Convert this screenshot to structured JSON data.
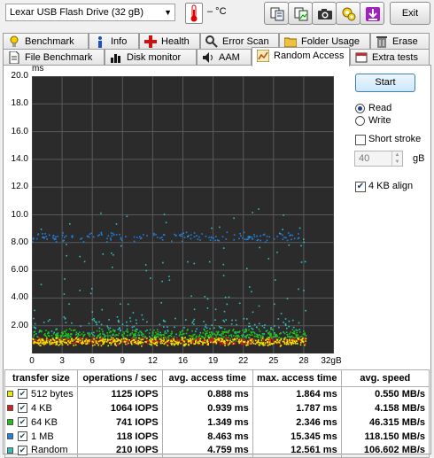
{
  "toolbar": {
    "drive": "Lexar   USB Flash Drive (32 gB)",
    "temperature": "– °C",
    "exit_label": "Exit"
  },
  "tabs_row1": [
    {
      "label": "Benchmark",
      "icon": "benchmark-icon"
    },
    {
      "label": "Info",
      "icon": "info-icon"
    },
    {
      "label": "Health",
      "icon": "health-icon"
    },
    {
      "label": "Error Scan",
      "icon": "error-scan-icon"
    },
    {
      "label": "Folder Usage",
      "icon": "folder-icon"
    },
    {
      "label": "Erase",
      "icon": "erase-icon"
    }
  ],
  "tabs_row2": [
    {
      "label": "File Benchmark",
      "icon": "file-benchmark-icon"
    },
    {
      "label": "Disk monitor",
      "icon": "disk-monitor-icon"
    },
    {
      "label": "AAM",
      "icon": "speaker-icon"
    },
    {
      "label": "Random Access",
      "icon": "random-access-icon",
      "active": true
    },
    {
      "label": "Extra tests",
      "icon": "extra-tests-icon"
    }
  ],
  "controls": {
    "start_label": "Start",
    "read_label": "Read",
    "write_label": "Write",
    "mode_selected": "Read",
    "short_stroke_label": "Short stroke",
    "short_stroke_checked": false,
    "stroke_value": "40",
    "stroke_unit": "gB",
    "align_label": "4 KB align",
    "align_checked": true
  },
  "chart_data": {
    "type": "scatter",
    "ylabel": "ms",
    "xlabel": "",
    "x_unit_label": "32gB",
    "y_ticks": [
      "20.0",
      "18.0",
      "16.0",
      "14.0",
      "12.0",
      "10.0",
      "8.00",
      "6.00",
      "4.00",
      "2.00"
    ],
    "x_ticks": [
      "0",
      "3",
      "6",
      "9",
      "12",
      "16",
      "19",
      "22",
      "25",
      "28"
    ],
    "xlim": [
      0,
      32
    ],
    "ylim": [
      0,
      20
    ],
    "grid": true,
    "background": "#2b2b2b",
    "series": [
      {
        "name": "512 bytes",
        "color": "#e8e800",
        "y_center": 0.89,
        "y_spread": 0.35,
        "x_end": 29
      },
      {
        "name": "4 KB",
        "color": "#d02020",
        "y_center": 0.94,
        "y_spread": 0.3,
        "x_end": 29
      },
      {
        "name": "64 KB",
        "color": "#20c020",
        "y_center": 1.35,
        "y_spread": 0.5,
        "x_end": 29
      },
      {
        "name": "1 MB",
        "color": "#2080e0",
        "y_center": 8.46,
        "y_spread": 0.4,
        "x_end": 29
      },
      {
        "name": "Random",
        "color": "#30c0c0",
        "y_center": 4.76,
        "y_spread": 3.5,
        "x_end": 29
      }
    ]
  },
  "results": {
    "headers": [
      "transfer size",
      "operations / sec",
      "avg. access time",
      "max. access time",
      "avg. speed"
    ],
    "rows": [
      {
        "size": "512 bytes",
        "color": "#e8e800",
        "checked": true,
        "ops": "1125 IOPS",
        "avg": "0.888 ms",
        "max": "1.864 ms",
        "speed": "0.550 MB/s"
      },
      {
        "size": "4 KB",
        "color": "#d02020",
        "checked": true,
        "ops": "1064 IOPS",
        "avg": "0.939 ms",
        "max": "1.787 ms",
        "speed": "4.158 MB/s"
      },
      {
        "size": "64 KB",
        "color": "#20c020",
        "checked": true,
        "ops": "741 IOPS",
        "avg": "1.349 ms",
        "max": "2.346 ms",
        "speed": "46.315 MB/s"
      },
      {
        "size": "1 MB",
        "color": "#2080e0",
        "checked": true,
        "ops": "118 IOPS",
        "avg": "8.463 ms",
        "max": "15.345 ms",
        "speed": "118.150 MB/s"
      },
      {
        "size": "Random",
        "color": "#30c0c0",
        "checked": true,
        "ops": "210 IOPS",
        "avg": "4.759 ms",
        "max": "12.561 ms",
        "speed": "106.602 MB/s"
      }
    ]
  }
}
